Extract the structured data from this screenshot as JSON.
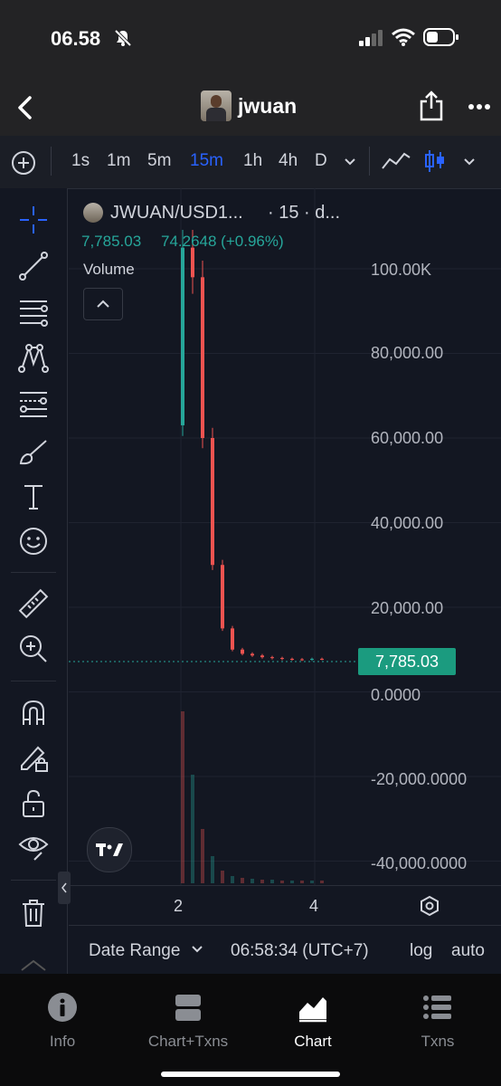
{
  "status": {
    "time": "06.58"
  },
  "header": {
    "title": "jwuan"
  },
  "timeframes": [
    "1s",
    "1m",
    "5m",
    "15m",
    "1h",
    "4h",
    "D"
  ],
  "active_timeframe": "15m",
  "legend": {
    "symbol": "JWUAN/USD1...",
    "interval": "· 15 · d...",
    "price": "7,785.03",
    "change": "74.2648 (+0.96%)",
    "volume_label": "Volume"
  },
  "y_axis": [
    "100.00K",
    "80,000.00",
    "60,000.00",
    "40,000.00",
    "20,000.00",
    "0.0000",
    "-20,000.0000",
    "-40,000.0000"
  ],
  "x_axis": [
    "2",
    "4"
  ],
  "last_price_label": "7,785.03",
  "bottom": {
    "date_range": "Date Range",
    "clock": "06:58:34 (UTC+7)",
    "log": "log",
    "auto": "auto"
  },
  "nav": [
    {
      "label": "Info"
    },
    {
      "label": "Chart+Txns"
    },
    {
      "label": "Chart"
    },
    {
      "label": "Txns"
    }
  ],
  "colors": {
    "up": "#26a69a",
    "down": "#ef5350",
    "accent": "#2962ff",
    "price_bg": "#1b9b7f"
  },
  "chart_data": {
    "type": "candlestick",
    "title": "JWUAN/USD1...",
    "y_ticks": [
      100000,
      80000,
      60000,
      40000,
      20000,
      0,
      -20000,
      -40000
    ],
    "x_ticks": [
      "2",
      "4"
    ],
    "last_price": 7785.03,
    "series": [
      {
        "name": "price",
        "values": [
          105000,
          98000,
          60000,
          30000,
          15000,
          10000,
          9000,
          8600,
          8200,
          8000,
          7800,
          7700,
          7600,
          7800,
          7785.03
        ]
      }
    ]
  }
}
